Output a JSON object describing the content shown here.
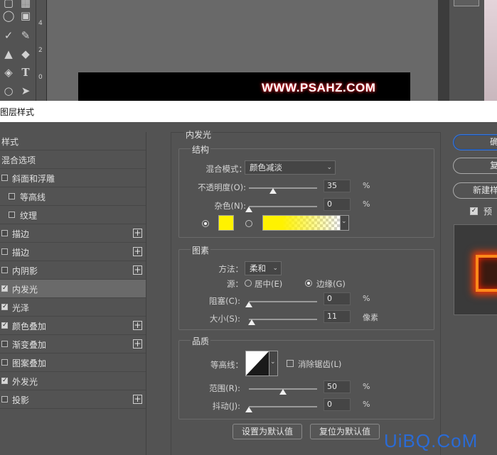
{
  "canvas": {
    "ruler_numbers": [
      "4",
      "2",
      "0"
    ],
    "watermark_text": "WWW.PSAHZ.COM"
  },
  "dialog": {
    "title": "图层样式",
    "title_visible": "图层样式"
  },
  "sidebar": {
    "header": "样式",
    "items": [
      {
        "label": "混合选项",
        "has_checkbox": false,
        "checked": false,
        "has_plus": false
      },
      {
        "label": "斜面和浮雕",
        "has_checkbox": true,
        "checked": false,
        "has_plus": false
      },
      {
        "label": "等高线",
        "has_checkbox": true,
        "checked": false,
        "has_plus": false,
        "indent": true
      },
      {
        "label": "纹理",
        "has_checkbox": true,
        "checked": false,
        "has_plus": false,
        "indent": true
      },
      {
        "label": "描边",
        "has_checkbox": true,
        "checked": false,
        "has_plus": true
      },
      {
        "label": "描边",
        "has_checkbox": true,
        "checked": false,
        "has_plus": true
      },
      {
        "label": "内阴影",
        "has_checkbox": true,
        "checked": false,
        "has_plus": true
      },
      {
        "label": "内发光",
        "has_checkbox": true,
        "checked": true,
        "has_plus": false,
        "selected": true
      },
      {
        "label": "光泽",
        "has_checkbox": true,
        "checked": true,
        "has_plus": false
      },
      {
        "label": "颜色叠加",
        "has_checkbox": true,
        "checked": true,
        "has_plus": true
      },
      {
        "label": "渐变叠加",
        "has_checkbox": true,
        "checked": false,
        "has_plus": true
      },
      {
        "label": "图案叠加",
        "has_checkbox": true,
        "checked": false,
        "has_plus": false
      },
      {
        "label": "外发光",
        "has_checkbox": true,
        "checked": true,
        "has_plus": false
      },
      {
        "label": "投影",
        "has_checkbox": true,
        "checked": false,
        "has_plus": true
      }
    ]
  },
  "panel": {
    "title": "内发光",
    "structure": {
      "title": "结构",
      "blend_mode_label": "混合模式：",
      "blend_mode_value": "颜色减淡",
      "opacity_label": "不透明度(O):",
      "opacity_value": "35",
      "opacity_fraction": 0.35,
      "noise_label": "杂色(N):",
      "noise_value": "0",
      "noise_fraction": 0,
      "percent": "%",
      "color_swatch": "#fff200",
      "gradient_colors": [
        "#fff200",
        "#ffffff"
      ]
    },
    "elements": {
      "title": "图素",
      "method_label": "方法：",
      "method_value": "柔和",
      "source_label": "源：",
      "source_center": "居中(E)",
      "source_edge": "边缘(G)",
      "choke_label": "阻塞(C):",
      "choke_value": "0",
      "choke_fraction": 0,
      "size_label": "大小(S):",
      "size_value": "11",
      "size_fraction": 0.045,
      "px_unit": "像素",
      "percent": "%"
    },
    "quality": {
      "title": "品质",
      "contour_label": "等高线：",
      "antialias_label": "消除锯齿(L)",
      "range_label": "范围(R):",
      "range_value": "50",
      "range_fraction": 0.5,
      "jitter_label": "抖动(J):",
      "jitter_value": "0",
      "jitter_fraction": 0,
      "percent": "%"
    },
    "set_default": "设置为默认值",
    "reset_default": "复位为默认值"
  },
  "right": {
    "ok": "确",
    "reset": "复",
    "new_style": "新建样",
    "preview_label": "预"
  },
  "site_watermark": "UiBQ.CoM",
  "colors": {
    "accent": "#3c78d8",
    "glow": "#ff8a1a"
  }
}
